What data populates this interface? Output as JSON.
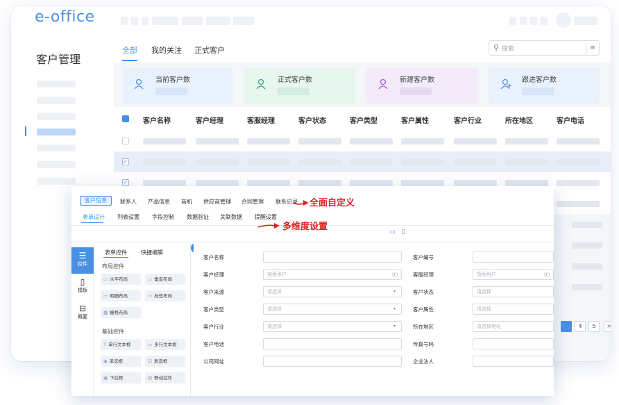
{
  "app": {
    "logo": "e-office",
    "sidebar_title": "客户管理"
  },
  "tabs": [
    {
      "label": "全部",
      "active": true
    },
    {
      "label": "我的关注",
      "active": false
    },
    {
      "label": "正式客户",
      "active": false
    }
  ],
  "search": {
    "placeholder": "搜索"
  },
  "stats": [
    {
      "label": "当前客户数",
      "icon": "users-icon",
      "color": "#4a90e2",
      "bg": "#e9f2fc",
      "bar": "#d6e6f8"
    },
    {
      "label": "正式客户数",
      "icon": "user-icon",
      "color": "#2eaa6a",
      "bg": "#e7f6ee",
      "bar": "#d2ecde"
    },
    {
      "label": "新建客户数",
      "icon": "users-icon",
      "color": "#a35bd1",
      "bg": "#f3eafa",
      "bar": "#e6d7f2"
    },
    {
      "label": "跟进客户数",
      "icon": "user-add-icon",
      "color": "#4a90e2",
      "bg": "#e9f2fc",
      "bar": "#d6e6f8"
    }
  ],
  "table": {
    "columns": [
      "客户名称",
      "客户经理",
      "客服经理",
      "客户状态",
      "客户类型",
      "客户属性",
      "客户行业",
      "所在地区",
      "客户电话"
    ]
  },
  "pagination": {
    "pages": [
      "4",
      "5"
    ],
    "next": ">"
  },
  "editor": {
    "top_tabs": [
      {
        "label": "客户信息",
        "active": true
      },
      {
        "label": "联系人",
        "active": false
      },
      {
        "label": "产品信息",
        "active": false
      },
      {
        "label": "商机",
        "active": false
      },
      {
        "label": "供应商管理",
        "active": false
      },
      {
        "label": "合同管理",
        "active": false
      },
      {
        "label": "联系记录",
        "active": false
      }
    ],
    "sub_tabs": [
      {
        "label": "表单设计",
        "active": true
      },
      {
        "label": "列表设置",
        "active": false
      },
      {
        "label": "字段控制",
        "active": false
      },
      {
        "label": "数据验证",
        "active": false
      },
      {
        "label": "关联数据",
        "active": false
      },
      {
        "label": "提醒设置",
        "active": false
      }
    ],
    "annotation_1": "全面自定义",
    "annotation_2": "多维度设置",
    "rail": [
      {
        "label": "控件",
        "glyph": "☰",
        "active": true
      },
      {
        "label": "模板",
        "glyph": "▯",
        "active": false
      },
      {
        "label": "概要",
        "glyph": "⊟",
        "active": false
      }
    ],
    "panel_tabs": [
      "表单控件",
      "快捷编辑"
    ],
    "layout_section": "布局控件",
    "layout_controls": [
      {
        "label": "水平布局",
        "glyph": "▭"
      },
      {
        "label": "垂直布局",
        "glyph": "▭"
      },
      {
        "label": "明细布局",
        "glyph": "▭"
      },
      {
        "label": "标签布局",
        "glyph": "▭"
      },
      {
        "label": "栅格布局",
        "glyph": "▦"
      }
    ],
    "basic_section": "基础控件",
    "basic_controls": [
      {
        "label": "单行文本框",
        "glyph": "T"
      },
      {
        "label": "多行文本框",
        "glyph": "▭"
      },
      {
        "label": "单选框",
        "glyph": "◉"
      },
      {
        "label": "复选框",
        "glyph": "☑"
      },
      {
        "label": "下拉框",
        "glyph": "▣"
      },
      {
        "label": "联动控件",
        "glyph": "▤"
      }
    ],
    "form_left": [
      {
        "label": "客户名称",
        "placeholder": "",
        "kind": "text"
      },
      {
        "label": "客户经理",
        "placeholder": "搜索用户",
        "kind": "user"
      },
      {
        "label": "客户来源",
        "placeholder": "请选择",
        "kind": "select"
      },
      {
        "label": "客户类型",
        "placeholder": "请选择",
        "kind": "select"
      },
      {
        "label": "客户行业",
        "placeholder": "请选择",
        "kind": "select"
      },
      {
        "label": "客户电话",
        "placeholder": "",
        "kind": "text"
      },
      {
        "label": "公司网址",
        "placeholder": "",
        "kind": "text"
      }
    ],
    "form_right": [
      {
        "label": "客户编号",
        "placeholder": "",
        "kind": "text"
      },
      {
        "label": "客服经理",
        "placeholder": "搜索用户",
        "kind": "user"
      },
      {
        "label": "客户状态",
        "placeholder": "请选择",
        "kind": "text"
      },
      {
        "label": "客户属性",
        "placeholder": "请选择",
        "kind": "text"
      },
      {
        "label": "所在地区",
        "placeholder": "请选择地址",
        "kind": "text"
      },
      {
        "label": "传真号码",
        "placeholder": "",
        "kind": "text"
      },
      {
        "label": "企业法人",
        "placeholder": "",
        "kind": "text"
      }
    ]
  }
}
